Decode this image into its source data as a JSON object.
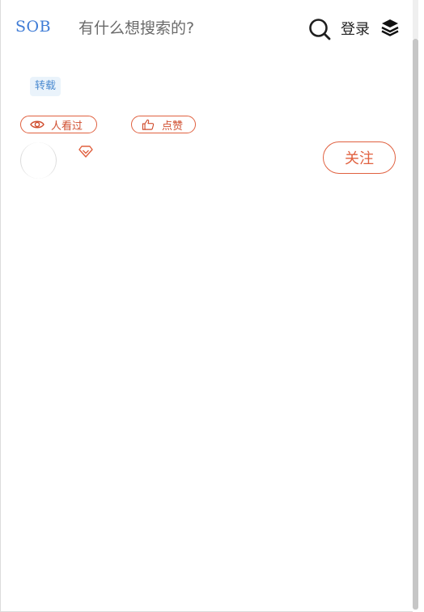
{
  "header": {
    "logo": "SOB",
    "search": {
      "placeholder": "有什么想搜索的?",
      "value": ""
    },
    "login_label": "登录",
    "icons": [
      "search-icon",
      "layers-icon"
    ]
  },
  "article": {
    "tag": "转载",
    "views_label": "人看过",
    "like_label": "点赞",
    "follow_label": "关注",
    "icons": [
      "eye-icon",
      "thumbs-up-icon",
      "vip-diamond-icon"
    ]
  },
  "colors": {
    "logo": "#3f7cd6",
    "accent": "#e0603f",
    "tag_bg": "#eaf3fb",
    "tag_text": "#4a8ad0"
  }
}
